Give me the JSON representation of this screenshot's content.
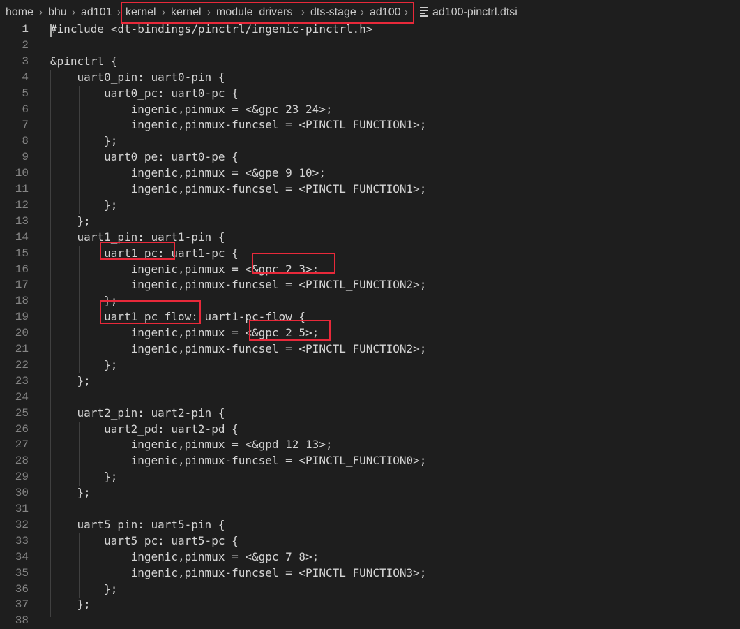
{
  "breadcrumb": {
    "items": [
      "home",
      "bhu",
      "ad101",
      "kernel",
      "kernel",
      "module_drivers",
      "dts-stage",
      "ad100"
    ],
    "file": "ad100-pinctrl.dtsi",
    "file_icon": "lines-file-icon"
  },
  "editor": {
    "active_line": 1,
    "lines": [
      {
        "n": "1",
        "text": "#include <dt-bindings/pinctrl/ingenic-pinctrl.h>"
      },
      {
        "n": "2",
        "text": ""
      },
      {
        "n": "3",
        "text": "&pinctrl {"
      },
      {
        "n": "4",
        "text": "    uart0_pin: uart0-pin {"
      },
      {
        "n": "5",
        "text": "        uart0_pc: uart0-pc {"
      },
      {
        "n": "6",
        "text": "            ingenic,pinmux = <&gpc 23 24>;"
      },
      {
        "n": "7",
        "text": "            ingenic,pinmux-funcsel = <PINCTL_FUNCTION1>;"
      },
      {
        "n": "8",
        "text": "        };"
      },
      {
        "n": "9",
        "text": "        uart0_pe: uart0-pe {"
      },
      {
        "n": "10",
        "text": "            ingenic,pinmux = <&gpe 9 10>;"
      },
      {
        "n": "11",
        "text": "            ingenic,pinmux-funcsel = <PINCTL_FUNCTION1>;"
      },
      {
        "n": "12",
        "text": "        };"
      },
      {
        "n": "13",
        "text": "    };"
      },
      {
        "n": "14",
        "text": "    uart1_pin: uart1-pin {"
      },
      {
        "n": "15",
        "text": "        uart1_pc: uart1-pc {"
      },
      {
        "n": "16",
        "text": "            ingenic,pinmux = <&gpc 2 3>;"
      },
      {
        "n": "17",
        "text": "            ingenic,pinmux-funcsel = <PINCTL_FUNCTION2>;"
      },
      {
        "n": "18",
        "text": "        };"
      },
      {
        "n": "19",
        "text": "        uart1_pc_flow: uart1-pc-flow {"
      },
      {
        "n": "20",
        "text": "            ingenic,pinmux = <&gpc 2 5>;"
      },
      {
        "n": "21",
        "text": "            ingenic,pinmux-funcsel = <PINCTL_FUNCTION2>;"
      },
      {
        "n": "22",
        "text": "        };"
      },
      {
        "n": "23",
        "text": "    };"
      },
      {
        "n": "24",
        "text": ""
      },
      {
        "n": "25",
        "text": "    uart2_pin: uart2-pin {"
      },
      {
        "n": "26",
        "text": "        uart2_pd: uart2-pd {"
      },
      {
        "n": "27",
        "text": "            ingenic,pinmux = <&gpd 12 13>;"
      },
      {
        "n": "28",
        "text": "            ingenic,pinmux-funcsel = <PINCTL_FUNCTION0>;"
      },
      {
        "n": "29",
        "text": "        };"
      },
      {
        "n": "30",
        "text": "    };"
      },
      {
        "n": "31",
        "text": ""
      },
      {
        "n": "32",
        "text": "    uart5_pin: uart5-pin {"
      },
      {
        "n": "33",
        "text": "        uart5_pc: uart5-pc {"
      },
      {
        "n": "34",
        "text": "            ingenic,pinmux = <&gpc 7 8>;"
      },
      {
        "n": "35",
        "text": "            ingenic,pinmux-funcsel = <PINCTL_FUNCTION3>;"
      },
      {
        "n": "36",
        "text": "        };"
      },
      {
        "n": "37",
        "text": "    };"
      },
      {
        "n": "38",
        "text": ""
      }
    ]
  },
  "colors": {
    "background": "#1e1e1e",
    "text": "#d4d4d4",
    "line_number": "#858585",
    "annotation": "#e8293a"
  }
}
